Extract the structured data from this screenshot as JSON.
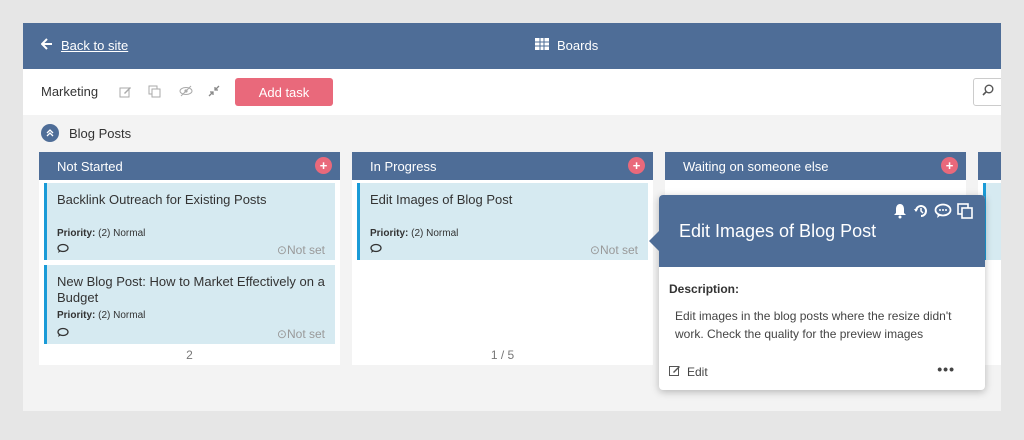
{
  "topbar": {
    "back_label": "Back to site",
    "boards_label": "Boards"
  },
  "toolbar": {
    "board_name": "Marketing",
    "add_task_label": "Add task",
    "icons": [
      "edit-icon",
      "copy-icon",
      "hide-icon",
      "collapse-icon"
    ]
  },
  "group": {
    "title": "Blog Posts"
  },
  "columns": [
    {
      "title": "Not Started",
      "count": "2",
      "cards": [
        {
          "title": "Backlink Outreach for Existing Posts",
          "priority_label": "Priority:",
          "priority_value": "(2) Normal",
          "due": "Not set"
        },
        {
          "title": "New Blog Post: How to Market Effectively on a Budget",
          "priority_label": "Priority:",
          "priority_value": "(2) Normal",
          "due": "Not set"
        }
      ]
    },
    {
      "title": "In Progress",
      "count": "1 / 5",
      "cards": [
        {
          "title": "Edit Images of Blog Post",
          "priority_label": "Priority:",
          "priority_value": "(2) Normal",
          "due": "Not set"
        }
      ]
    },
    {
      "title": "Waiting on someone else",
      "count": "",
      "cards": []
    }
  ],
  "popover": {
    "title": "Edit Images of Blog Post",
    "description_label": "Description:",
    "description": "Edit images in the blog posts where the resize didn't work. Check the quality for the preview images",
    "edit_label": "Edit",
    "more_label": "•••"
  },
  "colors": {
    "header": "#4e6d97",
    "accent": "#e9697b",
    "card_bg": "#d6eaf1",
    "card_border": "#1a9bd7"
  }
}
